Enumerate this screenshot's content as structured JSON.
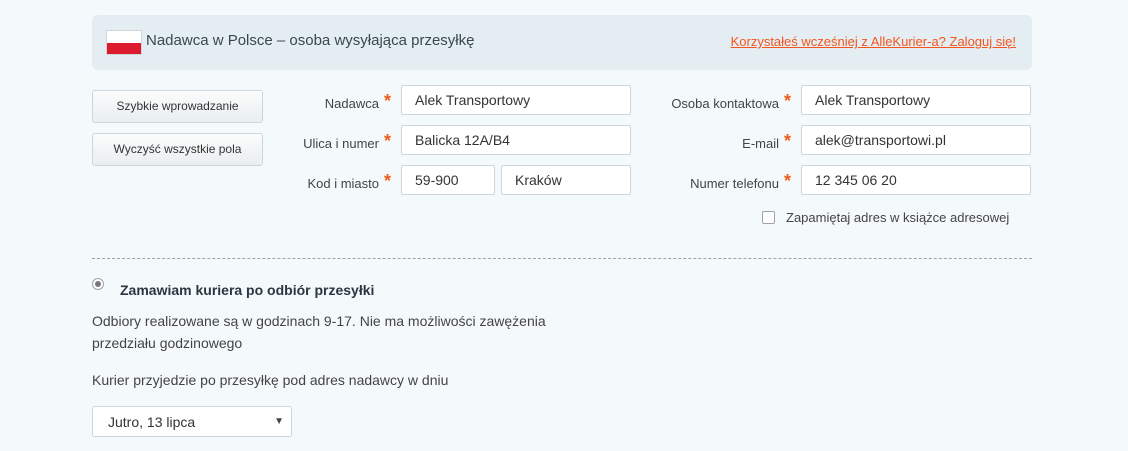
{
  "header": {
    "title": "Nadawca w Polsce – osoba wysyłająca przesyłkę",
    "login_link": "Korzystałeś wcześniej z AlleKurier-a? Zaloguj się!",
    "flag_colors": [
      "#ffffff",
      "#dc1c2e"
    ]
  },
  "actions": {
    "quick_entry": "Szybkie wprowadzanie",
    "clear_all": "Wyczyść wszystkie pola"
  },
  "form": {
    "sender": {
      "label": "Nadawca",
      "value": "Alek Transportowy"
    },
    "street": {
      "label": "Ulica i numer",
      "value": "Balicka 12A/B4"
    },
    "postal_city": {
      "label": "Kod i miasto",
      "postal_value": "59-900",
      "city_value": "Kraków"
    },
    "contact": {
      "label": "Osoba kontaktowa",
      "value": "Alek Transportowy"
    },
    "email": {
      "label": "E-mail",
      "value": "alek@transportowi.pl"
    },
    "phone": {
      "label": "Numer telefonu",
      "value": "12 345 06 20"
    },
    "required_mark": "*",
    "remember": {
      "label": "Zapamiętaj adres w książce adresowej",
      "checked": false
    }
  },
  "pickup": {
    "radio_label": "Zamawiam kuriera po odbiór przesyłki",
    "selected": true,
    "info": "Odbiory realizowane są w godzinach 9-17. Nie ma możliwości zawężenia przedziału godzinowego",
    "date_prompt": "Kurier przyjedzie po przesyłkę pod adres nadawcy w dniu",
    "date_selected": "Jutro, 13 lipca"
  },
  "colors": {
    "accent": "#f05a1a",
    "link": "#f4551e",
    "header_bg": "#e4edf2",
    "page_bg": "#f4f9fb"
  }
}
